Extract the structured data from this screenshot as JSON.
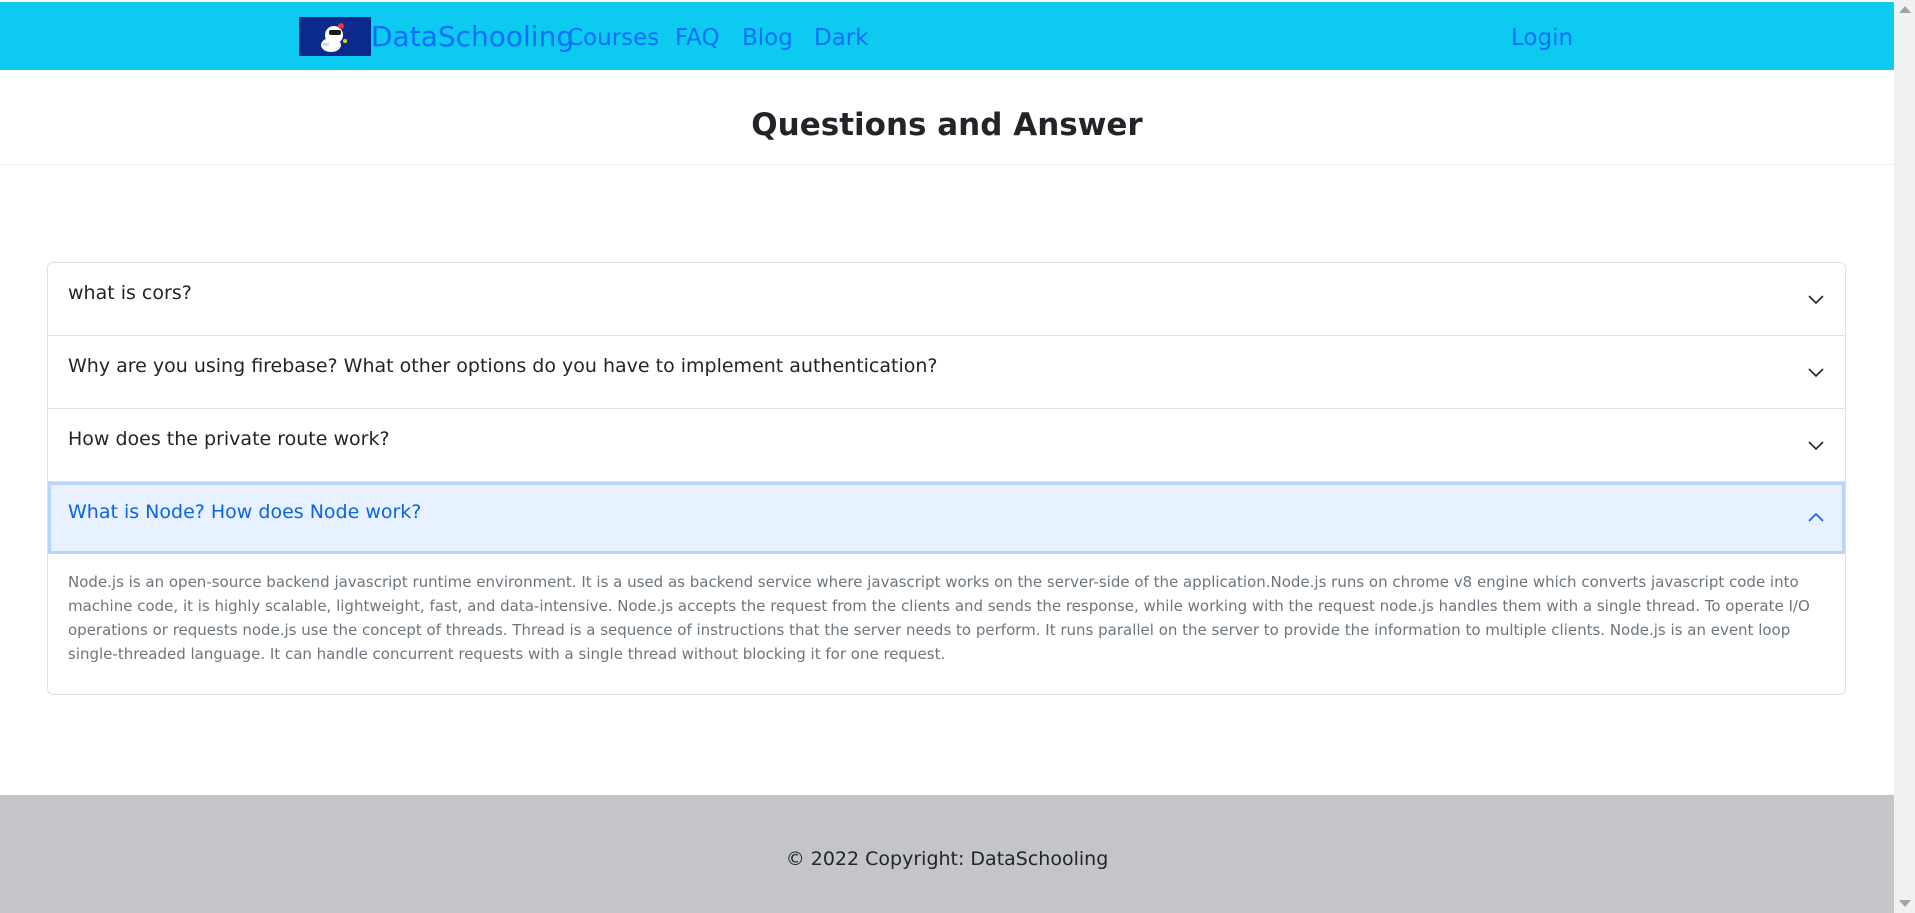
{
  "navbar": {
    "brand": "DataSchooling",
    "logo_icon": "robot-mascot-icon",
    "links": [
      "Courses",
      "FAQ",
      "Blog",
      "Dark"
    ],
    "login": "Login",
    "bg_color": "#0dcaf0",
    "link_color": "#0d6efd"
  },
  "header": {
    "title": "Questions and Answer"
  },
  "faq": {
    "items": [
      {
        "question": "what is cors?",
        "expanded": false
      },
      {
        "question": "Why are you using firebase? What other options do you have to implement authentication?",
        "expanded": false
      },
      {
        "question": "How does the private route work?",
        "expanded": false
      },
      {
        "question": "What is Node? How does Node work?",
        "expanded": true,
        "answer": "Node.js is an open-source backend javascript runtime environment. It is a used as backend service where javascript works on the server-side of the application.Node.js runs on chrome v8 engine which converts javascript code into machine code, it is highly scalable, lightweight, fast, and data-intensive. Node.js accepts the request from the clients and sends the response, while working with the request node.js handles them with a single thread. To operate I/O operations or requests node.js use the concept of threads. Thread is a sequence of instructions that the server needs to perform. It runs parallel on the server to provide the information to multiple clients. Node.js is an event loop single-threaded language. It can handle concurrent requests with a single thread without blocking it for one request."
      }
    ],
    "active_color": "#0c63e4",
    "active_bg": "#e7f1ff"
  },
  "footer": {
    "copyright": "© 2022 Copyright: DataSchooling",
    "bg_color": "#c4c5c8"
  }
}
